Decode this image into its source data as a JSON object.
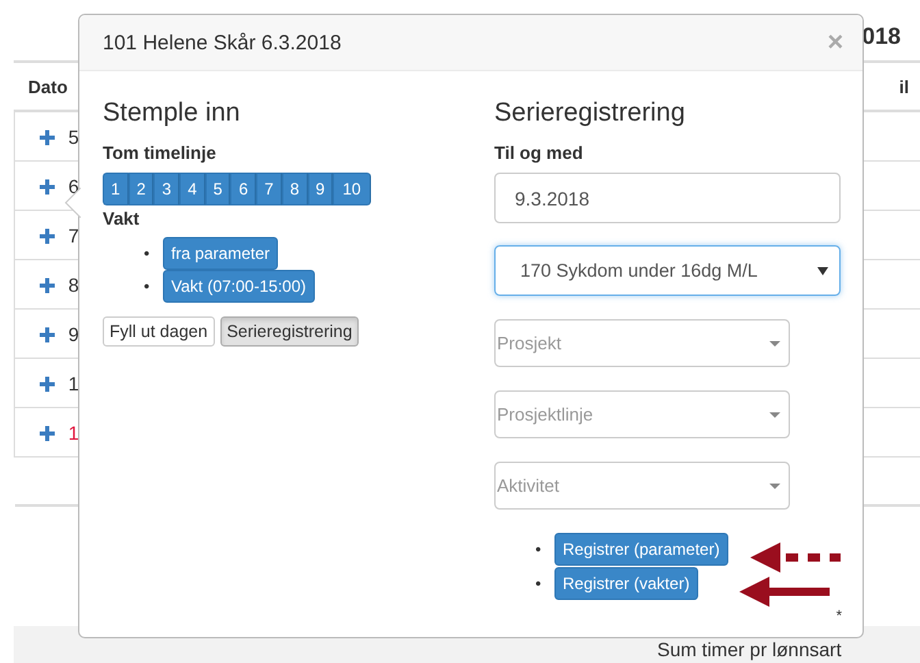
{
  "page": {
    "title_fragment": "018",
    "columns": [
      "Dato",
      "il"
    ],
    "rows": [
      {
        "date": "5",
        "alert": false
      },
      {
        "date": "6",
        "alert": false
      },
      {
        "date": "7",
        "alert": false
      },
      {
        "date": "8",
        "alert": false
      },
      {
        "date": "9",
        "alert": false
      },
      {
        "date": "1",
        "alert": false
      },
      {
        "date": "1",
        "alert": true
      }
    ],
    "footer": "Sum timer pr lønnsart"
  },
  "popover": {
    "title": "101 Helene Skår 6.3.2018",
    "close": "×",
    "left": {
      "heading": "Stemple inn",
      "timeline_label": "Tom timelinje",
      "timeline_buttons": [
        "1",
        "2",
        "3",
        "4",
        "5",
        "6",
        "7",
        "8",
        "9",
        "10"
      ],
      "shift_label": "Vakt",
      "shift_buttons": [
        {
          "bullet": "•",
          "label": "fra parameter"
        },
        {
          "bullet": "•",
          "label": "Vakt (07:00-15:00)"
        }
      ],
      "actions": [
        {
          "label": "Fyll ut dagen",
          "selected": false
        },
        {
          "label": "Serieregistrering",
          "selected": true
        }
      ]
    },
    "right": {
      "heading": "Serieregistrering",
      "date_label": "Til og med",
      "date_value": "9.3.2018",
      "code_select": {
        "value": "170 Sykdom under 16dg M/L",
        "focused": true
      },
      "selects": [
        {
          "placeholder": "Prosjekt"
        },
        {
          "placeholder": "Prosjektlinje"
        },
        {
          "placeholder": "Aktivitet"
        }
      ],
      "register_buttons": [
        {
          "bullet": "•",
          "label": "Registrer (parameter)"
        },
        {
          "bullet": "•",
          "label": "Registrer (vakter)"
        }
      ],
      "footnote": "*"
    }
  }
}
